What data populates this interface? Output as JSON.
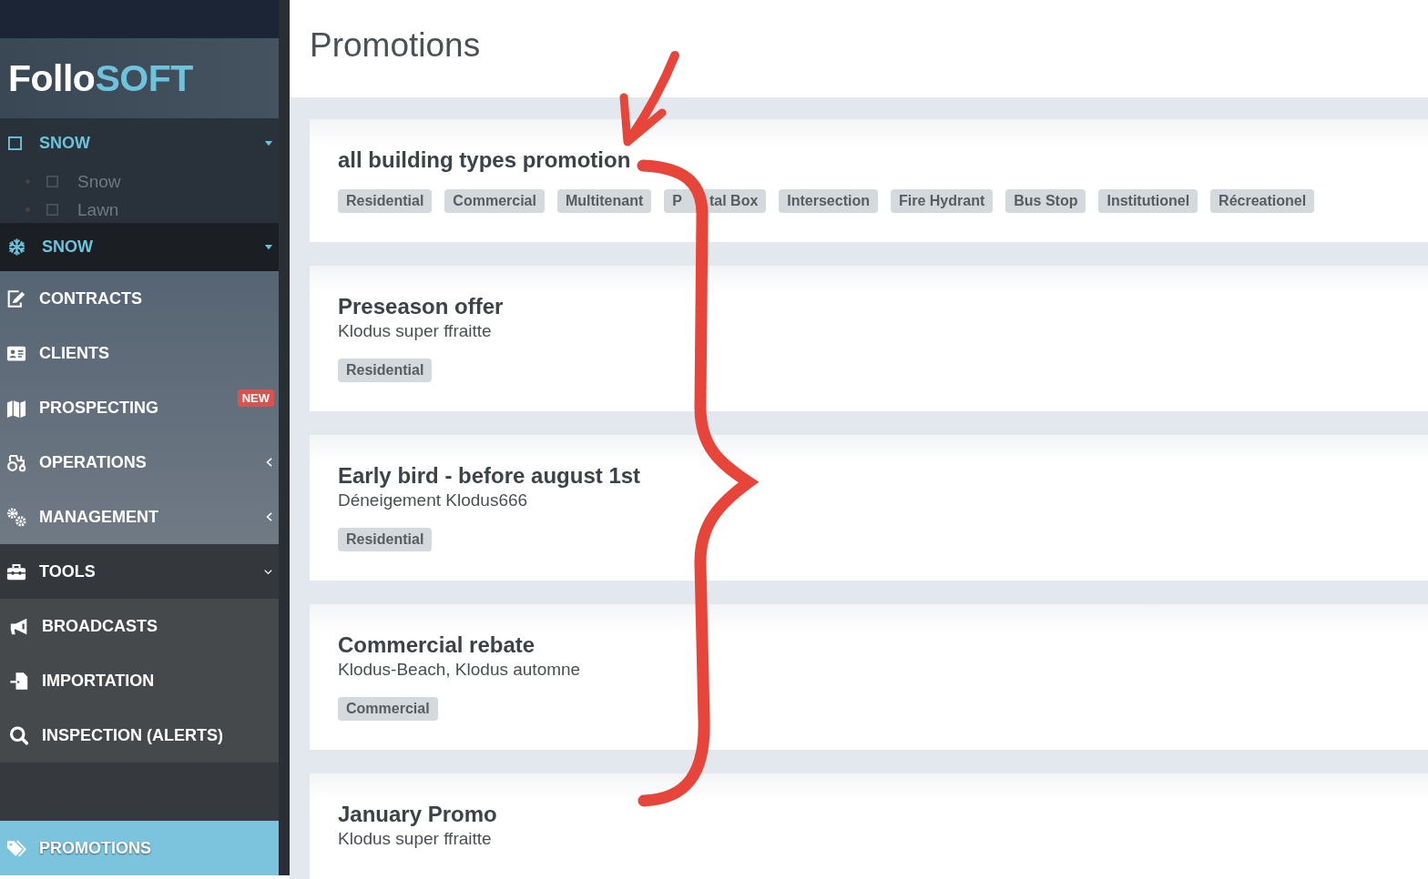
{
  "sidebar": {
    "logo": {
      "part_1": "Follo",
      "part_2": "SOFT"
    },
    "selectors": [
      {
        "label": "SNOW",
        "options": [
          {
            "label": "Snow"
          },
          {
            "label": "Lawn"
          }
        ]
      },
      {
        "label": "SNOW"
      }
    ],
    "items": [
      {
        "label": "CONTRACTS",
        "selected": false
      },
      {
        "label": "CLIENTS",
        "selected": false
      },
      {
        "label": "PROSPECTING",
        "badge": "NEW",
        "selected": false
      },
      {
        "label": "OPERATIONS",
        "expanded": false,
        "selected": false
      },
      {
        "label": "MANAGEMENT",
        "expanded": false,
        "selected": false
      },
      {
        "label": "TOOLS",
        "expanded": true,
        "selected": false,
        "children": [
          {
            "label": "BROADCASTS",
            "selected": false
          },
          {
            "label": "IMPORTATION",
            "selected": false
          },
          {
            "label": "INSPECTION (ALERTS)",
            "selected": false
          }
        ]
      },
      {
        "label": "PROMOTIONS",
        "selected": true
      }
    ]
  },
  "page_title": "Promotions",
  "promotions": [
    {
      "title": "all building types promotion",
      "tags": [
        "Residential",
        "Commercial",
        "Multitenant",
        [
          "P",
          "tal Box"
        ],
        "Intersection",
        "Fire Hydrant",
        "Bus Stop",
        "Institutionel",
        "Récreationel"
      ]
    },
    {
      "title": "Preseason offer",
      "subtitle": "Klodus super ffraitte",
      "tags": [
        "Residential"
      ]
    },
    {
      "title": "Early bird - before august 1st",
      "subtitle": "Déneigement Klodus666",
      "tags": [
        "Residential"
      ]
    },
    {
      "title": "Commercial rebate",
      "subtitle": "Klodus-Beach, Klodus automne",
      "tags": [
        "Commercial"
      ]
    },
    {
      "title": "January Promo",
      "subtitle": "Klodus super ffraitte"
    }
  ]
}
